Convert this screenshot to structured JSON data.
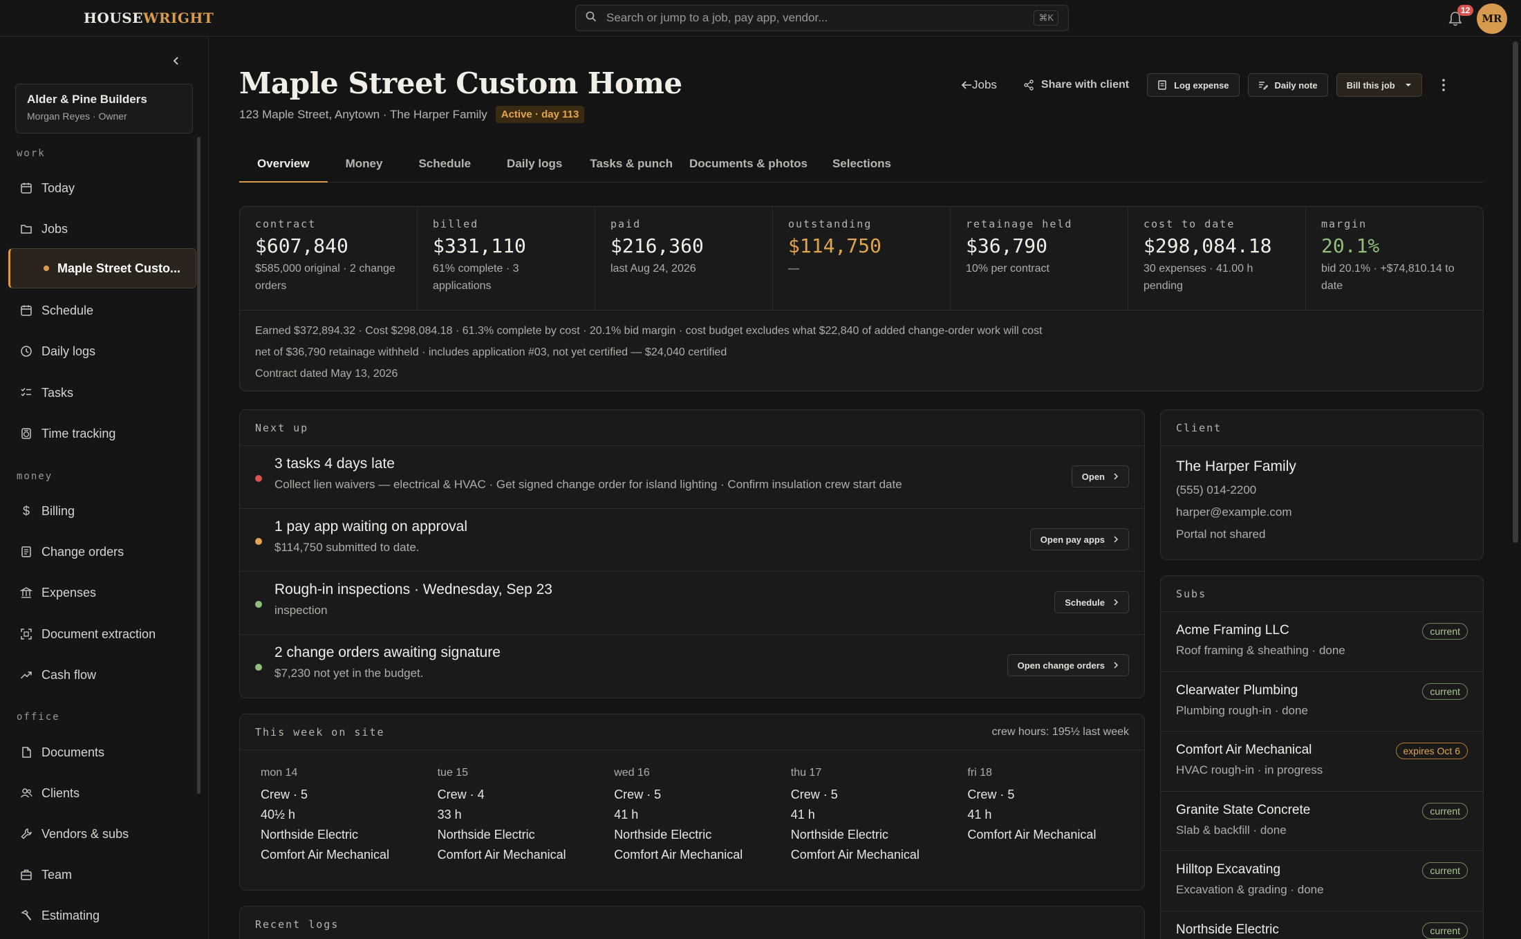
{
  "topbar": {
    "logo_part1": "HOUSE",
    "logo_part2": "WRIGHT",
    "search_placeholder": "Search or jump to a job, pay app, vendor...",
    "search_shortcut": "⌘K",
    "notification_count": "12",
    "avatar_initials": "MR"
  },
  "sidebar": {
    "org_name": "Alder & Pine Builders",
    "org_user": "Morgan Reyes · Owner",
    "sections": {
      "work": "work",
      "money": "money",
      "office": "office"
    },
    "items": {
      "today": "Today",
      "jobs": "Jobs",
      "current_job": "Maple Street Custo...",
      "schedule": "Schedule",
      "daily_logs": "Daily logs",
      "tasks": "Tasks",
      "time_tracking": "Time tracking",
      "billing": "Billing",
      "change_orders": "Change orders",
      "expenses": "Expenses",
      "document_extraction": "Document extraction",
      "cash_flow": "Cash flow",
      "documents": "Documents",
      "clients": "Clients",
      "vendors": "Vendors & subs",
      "team": "Team",
      "estimating": "Estimating"
    }
  },
  "header": {
    "title": "Maple Street Custom Home",
    "address": "123 Maple Street, Anytown · The Harper Family",
    "status": "Active · day 113",
    "back_jobs": "Jobs",
    "share": "Share with client",
    "log_expense": "Log expense",
    "daily_note": "Daily note",
    "bill_job": "Bill this job"
  },
  "tabs": [
    "Overview",
    "Money",
    "Schedule",
    "Daily logs",
    "Tasks & punch",
    "Documents & photos",
    "Selections"
  ],
  "metrics": [
    {
      "key": "contract",
      "value": "$607,840",
      "detail": "$585,000 original · 2 change orders",
      "tone": "normal"
    },
    {
      "key": "billed",
      "value": "$331,110",
      "detail": "61% complete · 3 applications",
      "tone": "normal"
    },
    {
      "key": "paid",
      "value": "$216,360",
      "detail": "last Aug 24, 2026",
      "tone": "normal"
    },
    {
      "key": "outstanding",
      "value": "$114,750",
      "detail": "—",
      "tone": "orange"
    },
    {
      "key": "retainage held",
      "value": "$36,790",
      "detail": "10% per contract",
      "tone": "normal"
    },
    {
      "key": "cost to date",
      "value": "$298,084.18",
      "detail": "30 expenses · 41.00 h pending",
      "tone": "normal"
    },
    {
      "key": "margin",
      "value": "20.1%",
      "detail": "bid 20.1% · +$74,810.14 to date",
      "tone": "green"
    }
  ],
  "metrics_footer": {
    "line1": "Earned $372,894.32 · Cost $298,084.18 · 61.3% complete by cost · 20.1% bid margin · cost budget excludes what $22,840 of added change-order work will cost",
    "line2": "net of $36,790 retainage withheld · includes application #03, not yet certified — $24,040 certified",
    "line3": "Contract dated May 13, 2026"
  },
  "next_up": {
    "heading": "Next up",
    "items": [
      {
        "title": "3 tasks 4 days late",
        "sub": "Collect lien waivers — electrical & HVAC · Get signed change order for island lighting · Confirm insulation crew start date",
        "button": "Open",
        "color": "#d9534f"
      },
      {
        "title": "1 pay app waiting on approval",
        "sub": "$114,750 submitted to date.",
        "button": "Open pay apps",
        "color": "#e1a54f"
      },
      {
        "title": "Rough-in inspections · Wednesday, Sep 23",
        "sub": "inspection",
        "button": "Schedule",
        "color": "#8fbf7a"
      },
      {
        "title": "2 change orders awaiting signature",
        "sub": "$7,230 not yet in the budget.",
        "button": "Open change orders",
        "color": "#8fbf7a"
      }
    ]
  },
  "week": {
    "heading": "This week on site",
    "crew_hours": "crew hours: 195½ last week",
    "days": [
      {
        "day": "mon 14",
        "crew": "Crew · 5",
        "hours": "40½ h",
        "subs": [
          "Northside Electric",
          "Comfort Air Mechanical"
        ]
      },
      {
        "day": "tue 15",
        "crew": "Crew · 4",
        "hours": "33 h",
        "subs": [
          "Northside Electric",
          "Comfort Air Mechanical"
        ]
      },
      {
        "day": "wed 16",
        "crew": "Crew · 5",
        "hours": "41 h",
        "subs": [
          "Northside Electric",
          "Comfort Air Mechanical"
        ]
      },
      {
        "day": "thu 17",
        "crew": "Crew · 5",
        "hours": "41 h",
        "subs": [
          "Northside Electric",
          "Comfort Air Mechanical"
        ]
      },
      {
        "day": "fri 18",
        "crew": "Crew · 5",
        "hours": "41 h",
        "subs": [
          "Comfort Air Mechanical"
        ]
      }
    ]
  },
  "recent_logs": {
    "heading": "Recent logs"
  },
  "client": {
    "heading": "Client",
    "name": "The Harper Family",
    "phone": "(555) 014-2200",
    "email": "harper@example.com",
    "portal": "Portal not shared"
  },
  "subs": {
    "heading": "Subs",
    "items": [
      {
        "name": "Acme Framing LLC",
        "desc": "Roof framing & sheathing · done",
        "tag": "current",
        "warn": false
      },
      {
        "name": "Clearwater Plumbing",
        "desc": "Plumbing rough-in · done",
        "tag": "current",
        "warn": false
      },
      {
        "name": "Comfort Air Mechanical",
        "desc": "HVAC rough-in · in progress",
        "tag": "expires Oct 6",
        "warn": true
      },
      {
        "name": "Granite State Concrete",
        "desc": "Slab & backfill · done",
        "tag": "current",
        "warn": false
      },
      {
        "name": "Hilltop Excavating",
        "desc": "Excavation & grading · done",
        "tag": "current",
        "warn": false
      },
      {
        "name": "Northside Electric",
        "desc": "",
        "tag": "current",
        "warn": false
      }
    ]
  }
}
